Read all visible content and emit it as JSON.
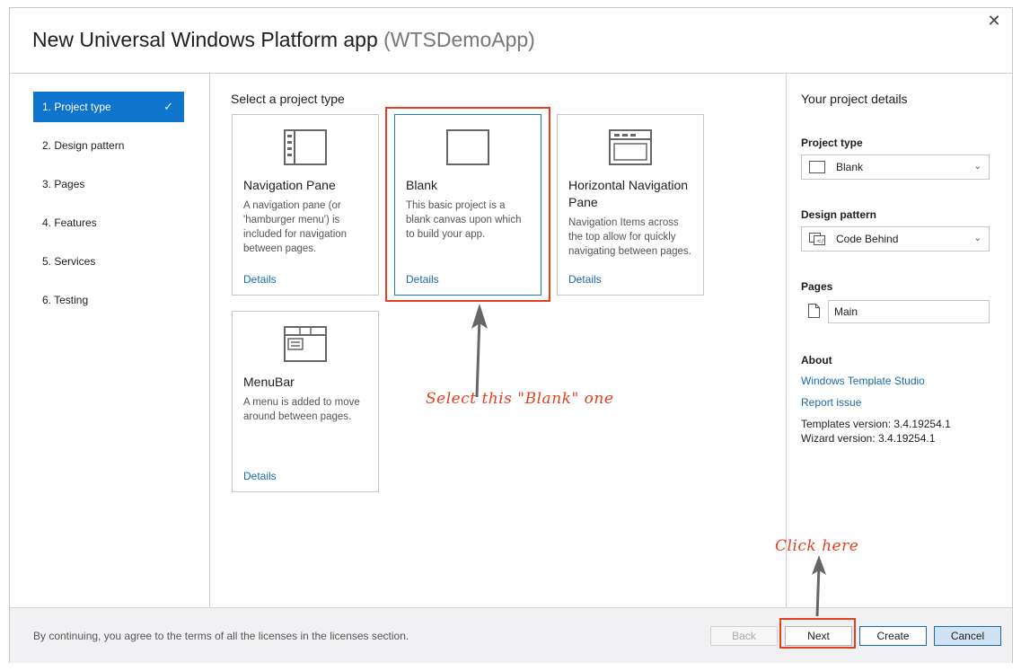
{
  "window": {
    "title": "New Universal Windows Platform app",
    "subtitle": "(WTSDemoApp)",
    "close_label": "✕"
  },
  "nav": {
    "items": [
      {
        "label": "1. Project type",
        "active": true
      },
      {
        "label": "2. Design pattern"
      },
      {
        "label": "3. Pages"
      },
      {
        "label": "4. Features"
      },
      {
        "label": "5. Services"
      },
      {
        "label": "6. Testing"
      }
    ],
    "check_glyph": "✓"
  },
  "main": {
    "heading": "Select a project type",
    "cards": [
      {
        "name": "Navigation Pane",
        "desc": "A navigation pane (or 'hamburger menu') is included for navigation between pages.",
        "details": "Details",
        "icon": "navigation-pane-icon"
      },
      {
        "name": "Blank",
        "desc": "This basic project is a blank canvas upon which to build your app.",
        "details": "Details",
        "icon": "blank-icon",
        "selected": true
      },
      {
        "name": "Horizontal Navigation Pane",
        "desc": "Navigation Items across the top allow for quickly navigating between pages.",
        "details": "Details",
        "icon": "horizontal-navigation-icon"
      },
      {
        "name": "MenuBar",
        "desc": "A menu is added to move around between pages.",
        "details": "Details",
        "icon": "menubar-icon"
      }
    ]
  },
  "annotations": {
    "select_blank": "Select this \"Blank\" one",
    "click_here": "Click here",
    "color": "#e2401f"
  },
  "details_panel": {
    "heading": "Your project details",
    "project_type_label": "Project type",
    "project_type_value": "Blank",
    "design_pattern_label": "Design pattern",
    "design_pattern_value": "Code Behind",
    "pages_label": "Pages",
    "page_value": "Main",
    "about_label": "About",
    "link_studio": "Windows Template Studio",
    "link_report": "Report issue",
    "templates_version": "Templates version: 3.4.19254.1",
    "wizard_version": "Wizard version: 3.4.19254.1"
  },
  "footer": {
    "license_text": "By continuing, you agree to the terms of all the licenses in the licenses section.",
    "back_label": "Back",
    "next_label": "Next",
    "create_label": "Create",
    "cancel_label": "Cancel"
  },
  "colors": {
    "accent": "#0e74cc",
    "link": "#1a6aa8"
  }
}
